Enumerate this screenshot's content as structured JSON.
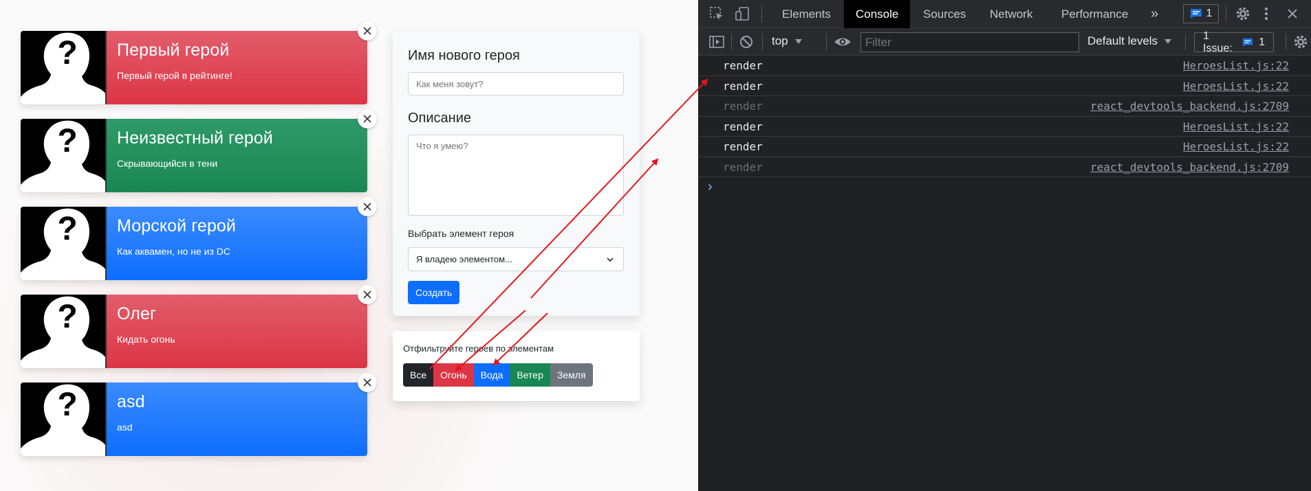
{
  "app": {
    "heroes": [
      {
        "name": "Первый герой",
        "description": "Первый герой в рейтинге!",
        "element_color": "#dc3545"
      },
      {
        "name": "Неизвестный герой",
        "description": "Скрывающийся в тени",
        "element_color": "#198754"
      },
      {
        "name": "Морской герой",
        "description": "Как аквамен, но не из DC",
        "element_color": "#0d6efd"
      },
      {
        "name": "Олег",
        "description": "Кидать огонь",
        "element_color": "#dc3545"
      },
      {
        "name": "asd",
        "description": "asd",
        "element_color": "#0d6efd"
      }
    ],
    "form": {
      "name_label": "Имя нового героя",
      "name_placeholder": "Как меня зовут?",
      "description_label": "Описание",
      "description_placeholder": "Что я умею?",
      "element_label": "Выбрать элемент героя",
      "element_selected": "Я владею элементом...",
      "submit_label": "Создать"
    },
    "filter": {
      "title": "Отфильтруйте героев по элементам",
      "buttons": [
        {
          "label": "Все",
          "color": "#212529"
        },
        {
          "label": "Огонь",
          "color": "#dc3545"
        },
        {
          "label": "Вода",
          "color": "#0d6efd"
        },
        {
          "label": "Ветер",
          "color": "#198754"
        },
        {
          "label": "Земля",
          "color": "#6c757d"
        }
      ]
    }
  },
  "devtools": {
    "tabs": [
      "Elements",
      "Console",
      "Sources",
      "Network",
      "Performance"
    ],
    "active_tab": "Console",
    "messages_badge": "1",
    "context": "top",
    "filter_placeholder": "Filter",
    "levels": "Default levels",
    "issues": "1 Issue:",
    "issues_count": "1",
    "logs": [
      {
        "message": "render",
        "source": "HeroesList.js:22",
        "dim": false
      },
      {
        "message": "render",
        "source": "HeroesList.js:22",
        "dim": false
      },
      {
        "message": "render",
        "source": "react_devtools_backend.js:2709",
        "dim": true
      },
      {
        "message": "render",
        "source": "HeroesList.js:22",
        "dim": false
      },
      {
        "message": "render",
        "source": "HeroesList.js:22",
        "dim": false
      },
      {
        "message": "render",
        "source": "react_devtools_backend.js:2709",
        "dim": true
      }
    ],
    "prompt_symbol": "›"
  },
  "annotation_color": "#e8141b"
}
